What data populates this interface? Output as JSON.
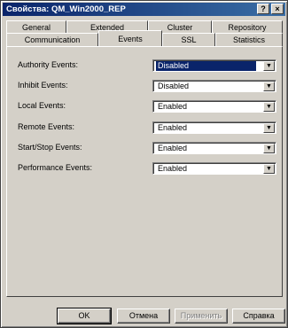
{
  "window": {
    "title": "Свойства: QM_Win2000_REP"
  },
  "titlebar_buttons": {
    "help": "?",
    "close": "×"
  },
  "tabs_row1": [
    "General",
    "Extended",
    "Cluster",
    "Repository"
  ],
  "tabs_row2": [
    "Communication",
    "Events",
    "SSL",
    "Statistics"
  ],
  "active_tab": "Events",
  "fields": [
    {
      "label": "Authority Events:",
      "value": "Disabled"
    },
    {
      "label": "Inhibit Events:",
      "value": "Disabled"
    },
    {
      "label": "Local Events:",
      "value": "Enabled"
    },
    {
      "label": "Remote Events:",
      "value": "Enabled"
    },
    {
      "label": "Start/Stop Events:",
      "value": "Enabled"
    },
    {
      "label": "Performance Events:",
      "value": "Enabled"
    }
  ],
  "buttons": {
    "ok": "OK",
    "cancel": "Отмена",
    "apply": "Применить",
    "help": "Справка"
  }
}
